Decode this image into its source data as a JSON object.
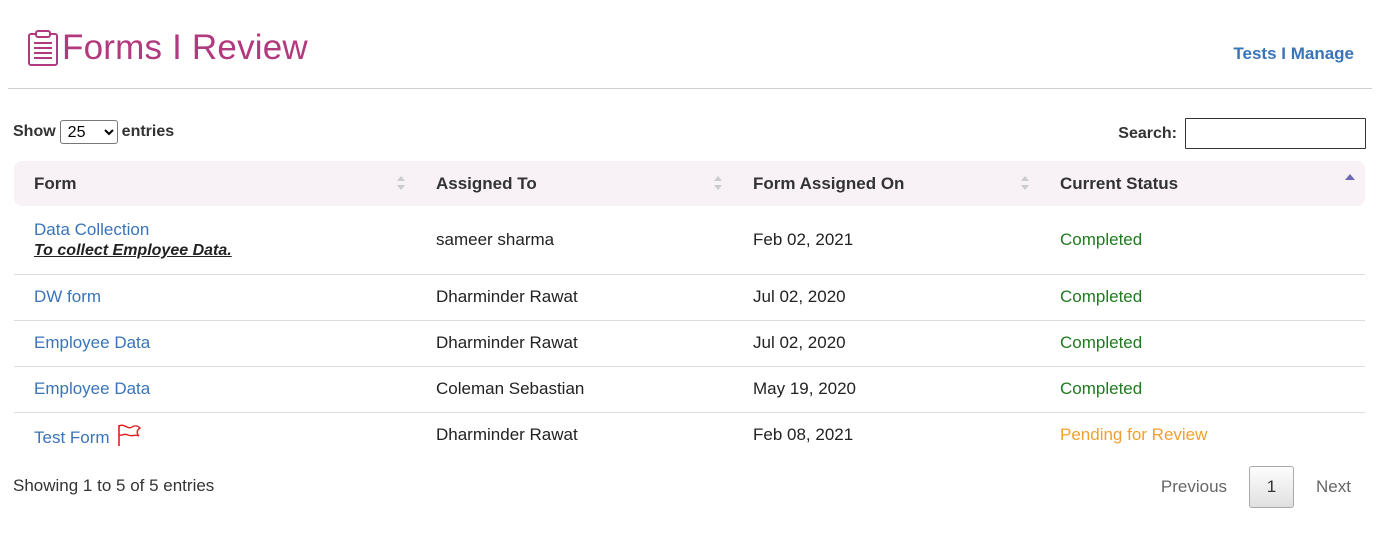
{
  "header": {
    "title": "Forms I Review",
    "links": [
      "Tests",
      "Manage"
    ],
    "link_separator": " I "
  },
  "controls": {
    "show_label": "Show",
    "entries_value": "25",
    "entries_label": "entries",
    "search_label": "Search:",
    "search_value": ""
  },
  "table": {
    "columns": [
      "Form",
      "Assigned To",
      "Form Assigned On",
      "Current Status"
    ],
    "rows": [
      {
        "form": "Data Collection",
        "description": "To collect Employee Data.",
        "assigned_to": "sameer sharma",
        "assigned_on": "Feb 02, 2021",
        "status": "Completed",
        "flagged": false
      },
      {
        "form": "DW form",
        "description": "",
        "assigned_to": "Dharminder Rawat",
        "assigned_on": "Jul 02, 2020",
        "status": "Completed",
        "flagged": false
      },
      {
        "form": "Employee Data",
        "description": "",
        "assigned_to": "Dharminder Rawat",
        "assigned_on": "Jul 02, 2020",
        "status": "Completed",
        "flagged": false
      },
      {
        "form": "Employee Data",
        "description": "",
        "assigned_to": "Coleman Sebastian",
        "assigned_on": "May 19, 2020",
        "status": "Completed",
        "flagged": false
      },
      {
        "form": "Test Form",
        "description": "",
        "assigned_to": "Dharminder Rawat",
        "assigned_on": "Feb 08, 2021",
        "status": "Pending for Review",
        "flagged": true
      }
    ]
  },
  "footer": {
    "info": "Showing 1 to 5 of 5 entries",
    "previous": "Previous",
    "current_page": "1",
    "next": "Next"
  },
  "colors": {
    "title": "#b13a7f",
    "link": "#3a74b8",
    "completed": "#1f7a1f",
    "pending": "#f0a030",
    "flag": "#e02020",
    "header_bg": "#f8f1f6"
  },
  "icons": {
    "title_icon": "clipboard-icon",
    "flag_icon": "flag-icon",
    "sort_icon": "sort-icon"
  }
}
